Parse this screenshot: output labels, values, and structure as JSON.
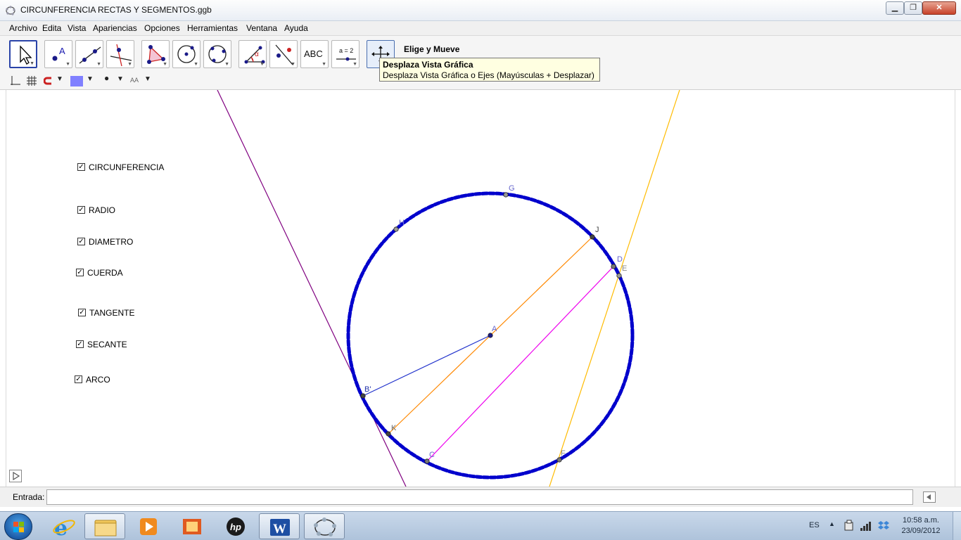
{
  "window": {
    "title": "CIRCUNFERENCIA RECTAS Y SEGMENTOS.ggb",
    "min_label": "▁",
    "max_label": "❐",
    "close_label": "✕"
  },
  "menu": [
    "Archivo",
    "Edita",
    "Vista",
    "Apariencias",
    "Opciones",
    "Herramientas",
    "Ventana",
    "Ayuda"
  ],
  "toolbar": {
    "current_tool_name": "Elige y Mueve",
    "tooltip_title": "Desplaza Vista Gráfica",
    "tooltip_text": "Desplaza Vista Gráfica o Ejes (Mayúsculas + Desplazar)",
    "text_tool_label": "ABC",
    "slider_tool_label": "a = 2"
  },
  "checkboxes": [
    {
      "label": "CIRCUNFERENCIA",
      "checked": true
    },
    {
      "label": "RADIO",
      "checked": true
    },
    {
      "label": "DIAMETRO",
      "checked": true
    },
    {
      "label": "CUERDA",
      "checked": true
    },
    {
      "label": "TANGENTE",
      "checked": true
    },
    {
      "label": "SECANTE",
      "checked": true
    },
    {
      "label": "ARCO",
      "checked": true
    }
  ],
  "checkmark": "✓",
  "points": {
    "A": "A",
    "B": "B'",
    "C": "C",
    "D": "D",
    "E": "E",
    "F": "F",
    "G": "G",
    "H": "H",
    "J": "J",
    "K": "K"
  },
  "input_bar": {
    "label": "Entrada:",
    "value": ""
  },
  "taskbar": {
    "language": "ES",
    "time": "10:58 a.m.",
    "date": "23/09/2012"
  },
  "colors": {
    "circle": "#0000cc",
    "radius": "#2233cc",
    "diameter": "#ff8800",
    "chord": "#ee00ee",
    "tangent": "#800080",
    "secant": "#ffbb00",
    "point_label": "#6666cc"
  }
}
